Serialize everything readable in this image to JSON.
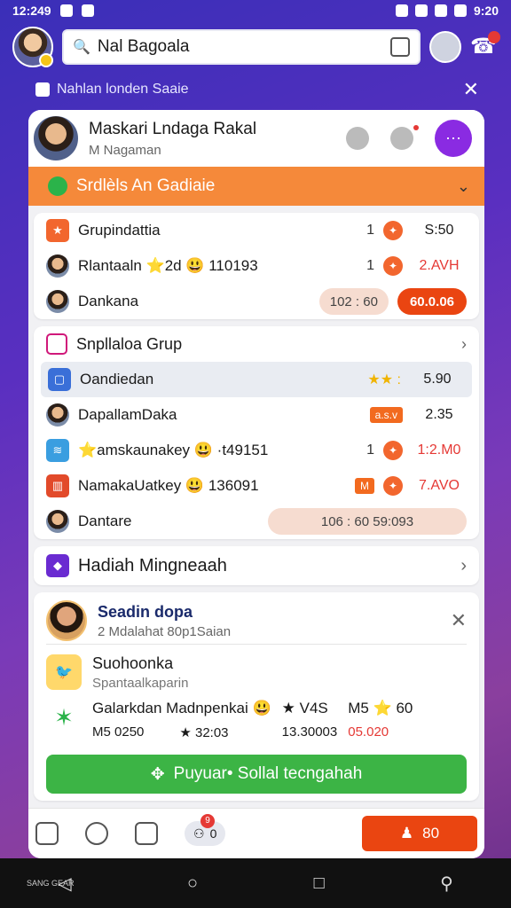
{
  "status": {
    "time": "12:249",
    "right_time": "9:20"
  },
  "search": {
    "value": "Nal Bagoala"
  },
  "notice": {
    "text": "Nahlan londen Saaie"
  },
  "profile": {
    "name": "Maskari Lndaga Rakal",
    "sub": "M Nagaman"
  },
  "banner": {
    "label": "Srdlèls An Gadiaie"
  },
  "section1": {
    "rows": [
      {
        "label": "Grupindattia",
        "num": "1",
        "val": "S:50"
      },
      {
        "label": "Rlantaaln ⭐2d 😃 110193",
        "num": "1",
        "val": "2.AVH"
      },
      {
        "label": "Dankana",
        "pill_pale": "102 : 60",
        "pill_red": "60.0.06"
      }
    ]
  },
  "section2": {
    "header": "Snpllaloa Grup",
    "rows": [
      {
        "label": "Oandiedan",
        "val": "5.90"
      },
      {
        "label": "DapallamDaka",
        "tag": "a.s.v",
        "val": "2.35"
      },
      {
        "label": "⭐amskaunakey 😃 ·t49151",
        "num": "1",
        "val": "1:2.M0"
      },
      {
        "label": "NamakaUatkey 😃 136091",
        "tag": "M",
        "val": "7.AVO"
      },
      {
        "label": "Dantare",
        "pill_pale": "106 : 60 59:093"
      }
    ]
  },
  "nav_head": {
    "label": "Hadiah Mingneaah"
  },
  "promo": {
    "title": "Seadin dopa",
    "subtitle": "2 Mdalahat 80p1Saian",
    "item_title": "Suohoonka",
    "item_sub": "Spantaalkaparin",
    "stat1": "Galarkdan Madnpenkai 😃",
    "stat1_sub": "M5 0250",
    "stat1_sub2": "★ 32:03",
    "stat2": "★ V4S",
    "stat2_sub": "13.30003",
    "stat3": "M5 ⭐ 60",
    "stat3_sub": "05.020",
    "cta": "Puyuar• Sollal tecngahah"
  },
  "bottom": {
    "pill_badge": "9",
    "pill_val": "0",
    "orange": "80"
  },
  "sys": {
    "left": "SANG\nGEAR"
  }
}
